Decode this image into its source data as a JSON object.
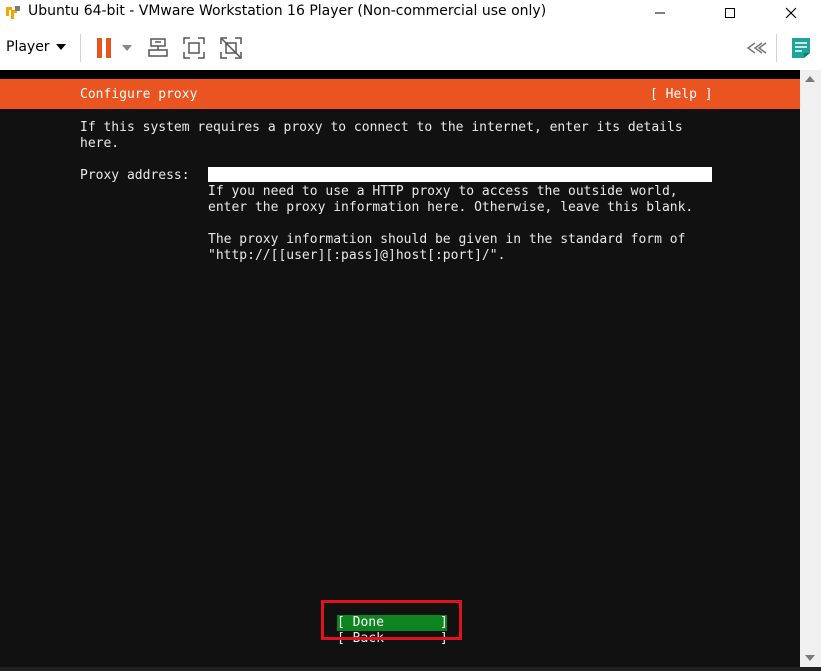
{
  "window": {
    "title": "Ubuntu 64-bit - VMware Workstation 16 Player (Non-commercial use only)"
  },
  "toolbar": {
    "player_label": "Player",
    "icons": [
      "pause-icon",
      "dropdown-arrow-icon",
      "send-ctrl-alt-del-icon",
      "full-screen-icon",
      "unity-icon",
      "collapse-icon",
      "notes-icon"
    ]
  },
  "installer": {
    "header_title": "Configure proxy",
    "header_help": "[ Help ]",
    "intro_lines": [
      "If this system requires a proxy to connect to the internet, enter its details",
      "here."
    ],
    "proxy_label": "Proxy address:",
    "proxy_value": "",
    "help_lines": [
      "If you need to use a HTTP proxy to access the outside world,",
      "enter the proxy information here. Otherwise, leave this blank.",
      "",
      "The proxy information should be given in the standard form of",
      "\"http://[[user][:pass]@]host[:port]/\"."
    ],
    "done_label": "[ Done",
    "done_bracket": "]",
    "back_label": "[ Back",
    "back_bracket": "]"
  },
  "colors": {
    "header_orange": "#e95420",
    "done_green": "#0e8420",
    "highlight_red": "#e0121b",
    "terminal_bg": "#111111"
  }
}
